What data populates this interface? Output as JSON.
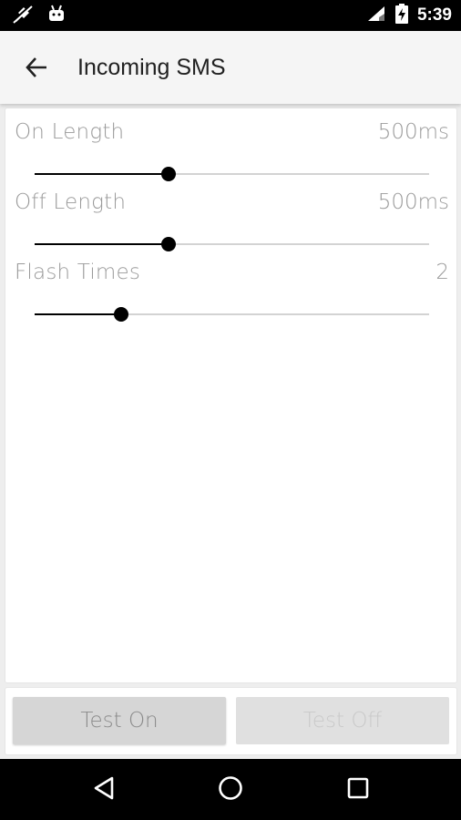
{
  "status_bar": {
    "time": "5:39",
    "left_icons": [
      "no-sim-icon",
      "android-icon"
    ],
    "right_icons": [
      "signal-icon",
      "battery-charging-icon"
    ]
  },
  "app_bar": {
    "title": "Incoming SMS",
    "back_icon": "arrow-back-icon"
  },
  "settings": [
    {
      "label": "On Length",
      "value": "500ms",
      "slider_fraction": 0.34
    },
    {
      "label": "Off Length",
      "value": "500ms",
      "slider_fraction": 0.34
    },
    {
      "label": "Flash Times",
      "value": "2",
      "slider_fraction": 0.22
    }
  ],
  "buttons": {
    "test_on": "Test On",
    "test_off": "Test Off",
    "test_off_enabled": false
  },
  "nav_bar": {
    "icons": [
      "back-triangle-icon",
      "home-circle-icon",
      "recents-square-icon"
    ]
  },
  "colors": {
    "accent": "#000000",
    "label_gray": "#9a9a9a",
    "track_gray": "#d3d3d3",
    "button_bg": "#d6d6d6"
  }
}
